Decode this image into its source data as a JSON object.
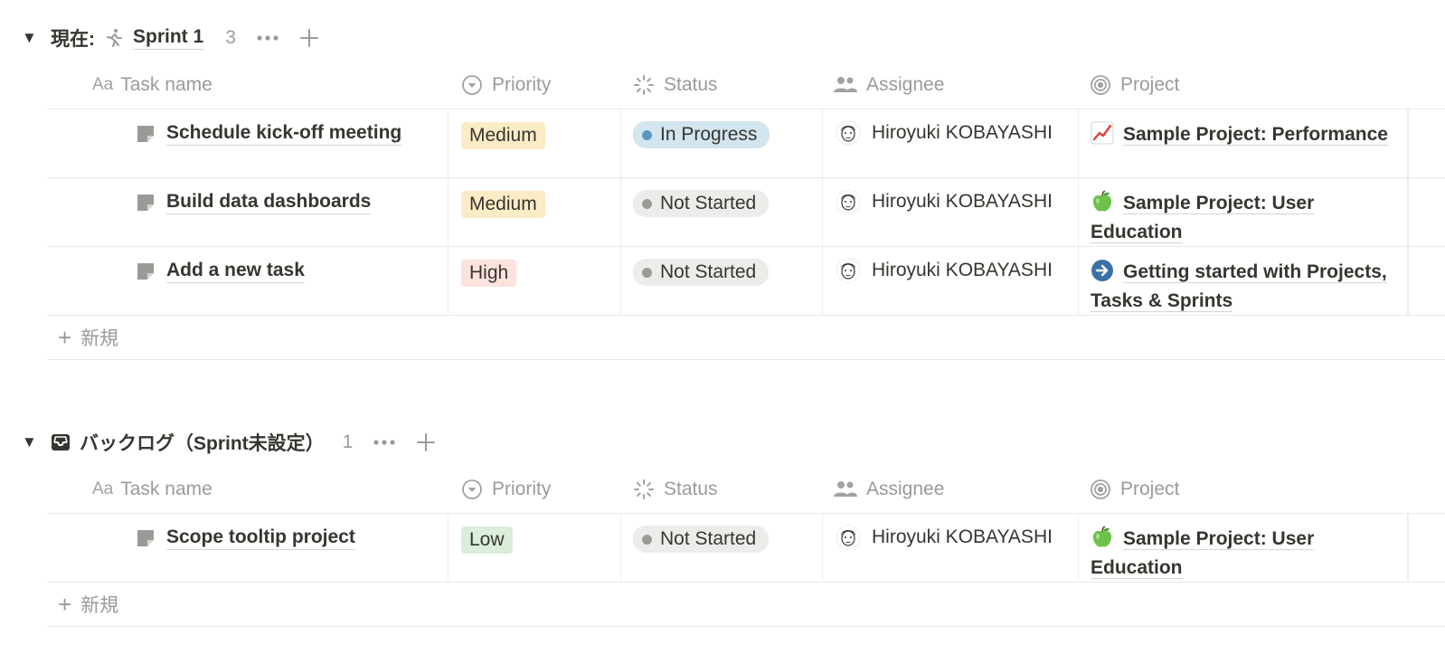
{
  "groups": [
    {
      "prefix": "現在:",
      "title": "Sprint 1",
      "count": "3",
      "icon": "runner-icon",
      "columns": {
        "task": "Task name",
        "priority": "Priority",
        "status": "Status",
        "assignee": "Assignee",
        "project": "Project"
      },
      "rows": [
        {
          "task": "Schedule kick-off meeting",
          "priority": "Medium",
          "status": "In Progress",
          "assignee": "Hiroyuki KOBAYASHI",
          "project_icon": "chart-up-icon",
          "project": "Sample Project: Performance"
        },
        {
          "task": "Build data dashboards",
          "priority": "Medium",
          "status": "Not Started",
          "assignee": "Hiroyuki KOBAYASHI",
          "project_icon": "green-apple-icon",
          "project": "Sample Project: User Education"
        },
        {
          "task": "Add a new task",
          "priority": "High",
          "status": "Not Started",
          "assignee": "Hiroyuki KOBAYASHI",
          "project_icon": "arrow-right-circle-icon",
          "project": "Getting started with Projects, Tasks & Sprints"
        }
      ],
      "new_label": "新規"
    },
    {
      "prefix": "",
      "title": "バックログ（Sprint未設定）",
      "count": "1",
      "icon": "inbox-icon",
      "columns": {
        "task": "Task name",
        "priority": "Priority",
        "status": "Status",
        "assignee": "Assignee",
        "project": "Project"
      },
      "rows": [
        {
          "task": "Scope tooltip project",
          "priority": "Low",
          "status": "Not Started",
          "assignee": "Hiroyuki KOBAYASHI",
          "project_icon": "green-apple-icon",
          "project": "Sample Project: User Education"
        }
      ],
      "new_label": "新規"
    }
  ],
  "colors": {
    "priority_medium": "#fbecc6",
    "priority_high": "#fde2dd",
    "priority_low": "#dbeddb",
    "status_in_progress_bg": "#d3e5ef",
    "status_in_progress_dot": "#5b97bd",
    "status_not_started_bg": "#ececea",
    "status_not_started_dot": "#9b9a97",
    "muted_text": "#9b9a97",
    "text": "#37352f"
  }
}
